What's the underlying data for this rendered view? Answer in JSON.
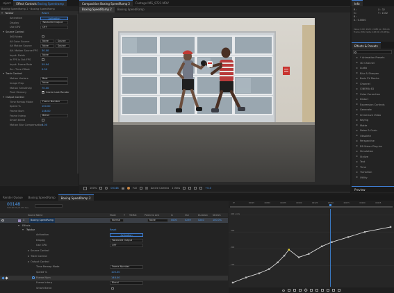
{
  "effect_controls": {
    "tab_label": "Effect Controls",
    "tab_layer": "Boxing Speedramp",
    "project_tab": "roject",
    "breadcrumb": "Boxing SpeedRamp 2 · Boxing SpeedRamp",
    "twixtor_label": "Twixtor",
    "reset_label": "Reset",
    "rows": [
      {
        "label": "Activation",
        "value": "Activation",
        "type": "button"
      },
      {
        "label": "Display",
        "value": "Twixtored Output",
        "type": "select"
      },
      {
        "label": "Use GPU",
        "value": "OFF",
        "type": "select"
      },
      {
        "label": "Source Control",
        "type": "group"
      },
      {
        "label": "360 Video",
        "type": "check"
      },
      {
        "label": "All Color Source",
        "value": "None",
        "value2": "Source",
        "type": "select2"
      },
      {
        "label": "Alt Motion Source",
        "value": "None",
        "value2": "Source",
        "type": "select2"
      },
      {
        "label": "Alt. Motion Source FPS",
        "value": "30.00",
        "type": "num"
      },
      {
        "label": "Input: Fields",
        "value": "None",
        "type": "select"
      },
      {
        "label": "In FPS is Out FPS",
        "type": "check"
      },
      {
        "label": "Input: Frame Rate",
        "value": "59.94",
        "type": "num"
      },
      {
        "label": "Src: Time Offset",
        "value": "0.00",
        "type": "num"
      },
      {
        "label": "Track Control",
        "type": "group"
      },
      {
        "label": "Motion Vectors",
        "value": "Best",
        "type": "select"
      },
      {
        "label": "Image Prep",
        "value": "None",
        "type": "select"
      },
      {
        "label": "Motion Sensitivity",
        "value": "70.00",
        "type": "num"
      },
      {
        "label": "Pixel Memory",
        "value": "Cache Last Render",
        "type": "check2"
      },
      {
        "label": "Output Control",
        "type": "group"
      },
      {
        "label": "Time Remap Mode",
        "value": "Frame Number",
        "type": "select"
      },
      {
        "label": "Speed %",
        "value": "100.00",
        "type": "num"
      },
      {
        "label": "Frame Num",
        "value": "148.00",
        "type": "num"
      },
      {
        "label": "Frame Interp",
        "value": "Blend",
        "type": "select"
      },
      {
        "label": "Smart Blend",
        "type": "check"
      },
      {
        "label": "Motion Blur Compensation",
        "value": "0.00",
        "type": "num"
      }
    ]
  },
  "composition": {
    "tabs": [
      {
        "label": "Composition Boxing SpeedRamp 2"
      },
      {
        "label": "Footage IMG_9721.MOV"
      }
    ],
    "subtabs": [
      {
        "label": "Boxing SpeedRamp 2"
      },
      {
        "label": "Boxing SpeedRamp"
      }
    ],
    "toolbar": {
      "zoom": "100%",
      "timecode": "00148",
      "resolution": "Full",
      "camera": "Active Camera",
      "view": "1 View",
      "exposure": "+0.0"
    }
  },
  "info_panel": {
    "title": "Info",
    "r": "R :",
    "g": "G :",
    "b": "B :",
    "a": "A : 0.0000",
    "x": "X : 32",
    "y": "Y : 1332",
    "note1": "Value: 0.00; 1920 x 1080 px, 360-ish",
    "note2": "Frame #18; Delta: 148:00; 23.98 fps"
  },
  "effects_presets": {
    "title": "Effects & Presets",
    "search_placeholder": "",
    "items": [
      "* Animation Presets",
      "3D Channel",
      "Audio",
      "Blur & Sharpen",
      "Boris FX Mocha",
      "Channel",
      "CINEMA 4D",
      "Color Correction",
      "Distort",
      "Expression Controls",
      "Generate",
      "Immersive Video",
      "Keying",
      "Matte",
      "Noise & Grain",
      "Obsolete",
      "Perspective",
      "RE:Vision Plug-ins",
      "Simulation",
      "Stylize",
      "Text",
      "Time",
      "Transition",
      "Utility"
    ],
    "preview_label": "Preview"
  },
  "timeline": {
    "tabs": [
      {
        "label": "Render Queue"
      },
      {
        "label": "Boxing SpeedRamp"
      },
      {
        "label": "Boxing SpeedRamp 2"
      }
    ],
    "timecode": "00148",
    "timecode_sub": "0:00:06:04 (23.976 fps)",
    "search_placeholder": "",
    "columns": [
      "Source Name",
      "Mode",
      "T",
      "TrkMat",
      "Parent & Link",
      "In",
      "Out",
      "Duration",
      "Stretch"
    ],
    "layer": {
      "index": "1",
      "name": "Boxing SpeedRamp",
      "mode": "Normal",
      "parent": "None",
      "in": "0000",
      "out": "0239",
      "duration": "0240",
      "stretch": "100.0%"
    },
    "effects_label": "Effects",
    "twixtor_label": "Twixtor",
    "reset_label": "Reset",
    "rows": [
      {
        "label": "Activation",
        "value": "Activation",
        "type": "button"
      },
      {
        "label": "Display",
        "value": "Twixtored Output",
        "type": "select"
      },
      {
        "label": "Use GPU",
        "value": "OFF",
        "type": "select"
      },
      {
        "label": "Source Control",
        "type": "group"
      },
      {
        "label": "Track Control",
        "type": "group"
      },
      {
        "label": "Output Control",
        "type": "group"
      },
      {
        "label": "Time Remap Mode",
        "value": "Frame Number",
        "type": "select"
      },
      {
        "label": "Speed %",
        "value": "100.00",
        "type": "num"
      },
      {
        "label": "Frame Num",
        "value": "148.00",
        "type": "num"
      },
      {
        "label": "Frame Interp",
        "value": "Blend",
        "type": "select"
      },
      {
        "label": "Smart Blend",
        "value": "",
        "type": "check"
      }
    ],
    "graph": {
      "y_labels": [
        "400 units",
        "300",
        "200",
        "100"
      ],
      "ruler_labels": [
        "0f",
        "00025",
        "00050",
        "00075",
        "00100",
        "00125",
        "00150",
        "00175",
        "00200",
        "00225"
      ],
      "keyframes": [
        {
          "frame": 0,
          "value": 0
        },
        {
          "frame": 20,
          "value": 30
        },
        {
          "frame": 40,
          "value": 55
        },
        {
          "frame": 55,
          "value": 80
        },
        {
          "frame": 68,
          "value": 120
        },
        {
          "frame": 78,
          "value": 160
        },
        {
          "frame": 85,
          "value": 195
        },
        {
          "frame": 100,
          "value": 150
        },
        {
          "frame": 115,
          "value": 170
        },
        {
          "frame": 135,
          "value": 215
        },
        {
          "frame": 150,
          "value": 240
        },
        {
          "frame": 175,
          "value": 270
        },
        {
          "frame": 200,
          "value": 300
        },
        {
          "frame": 239,
          "value": 330
        }
      ],
      "current_frame": 148,
      "frame_max": 240,
      "value_max": 420
    }
  }
}
